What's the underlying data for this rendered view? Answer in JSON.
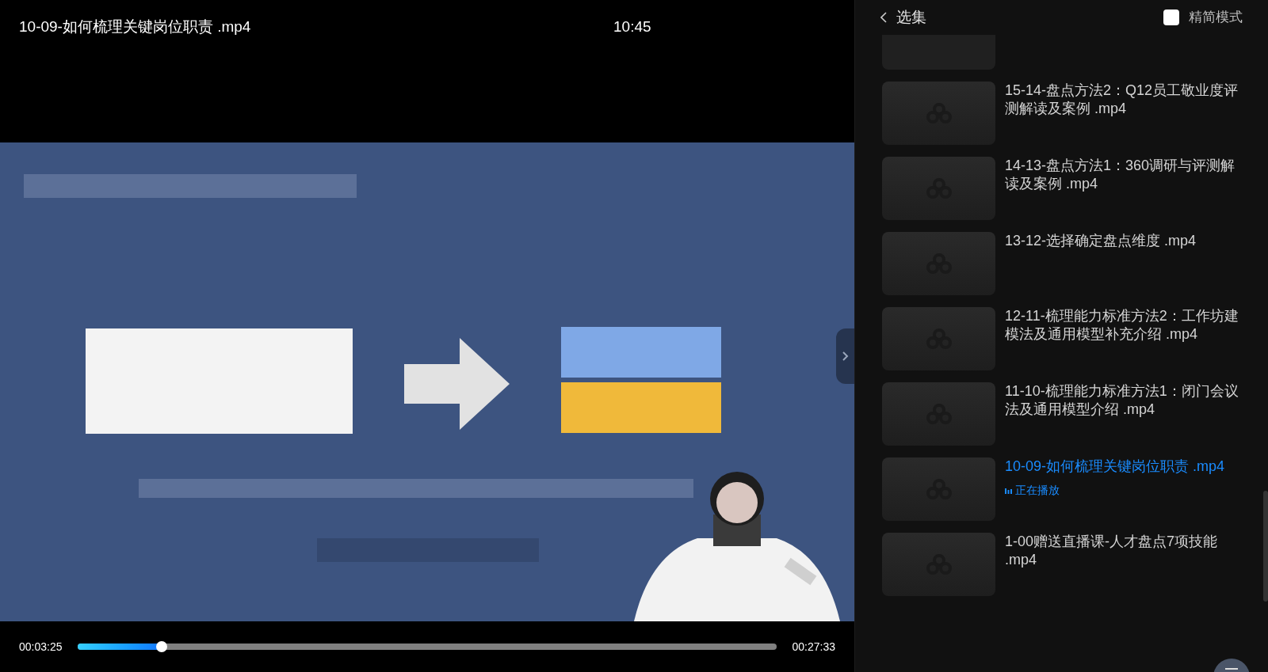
{
  "player": {
    "title": "10-09-如何梳理关键岗位职责 .mp4",
    "clock": "10:45",
    "progress": {
      "elapsed": "00:03:25",
      "total": "00:27:33",
      "level": 0.12
    }
  },
  "sidebar": {
    "back_label": "选集",
    "compact_mode": {
      "label": "精简模式",
      "checked": false
    },
    "episodes": [
      {
        "title": "15-14-盘点方法2：Q12员工敬业度评测解读及案例 .mp4",
        "selected": false
      },
      {
        "title": "14-13-盘点方法1：360调研与评测解读及案例 .mp4",
        "selected": false
      },
      {
        "title": "13-12-选择确定盘点维度 .mp4",
        "selected": false
      },
      {
        "title": "12-11-梳理能力标准方法2：工作坊建模法及通用模型补充介绍 .mp4",
        "selected": false
      },
      {
        "title": "11-10-梳理能力标准方法1：闭门会议法及通用模型介绍 .mp4",
        "selected": false
      },
      {
        "title": "10-09-如何梳理关键岗位职责 .mp4",
        "selected": true,
        "status": "正在播放"
      },
      {
        "title": "1-00赠送直播课-人才盘点7项技能 .mp4",
        "selected": false
      }
    ]
  }
}
